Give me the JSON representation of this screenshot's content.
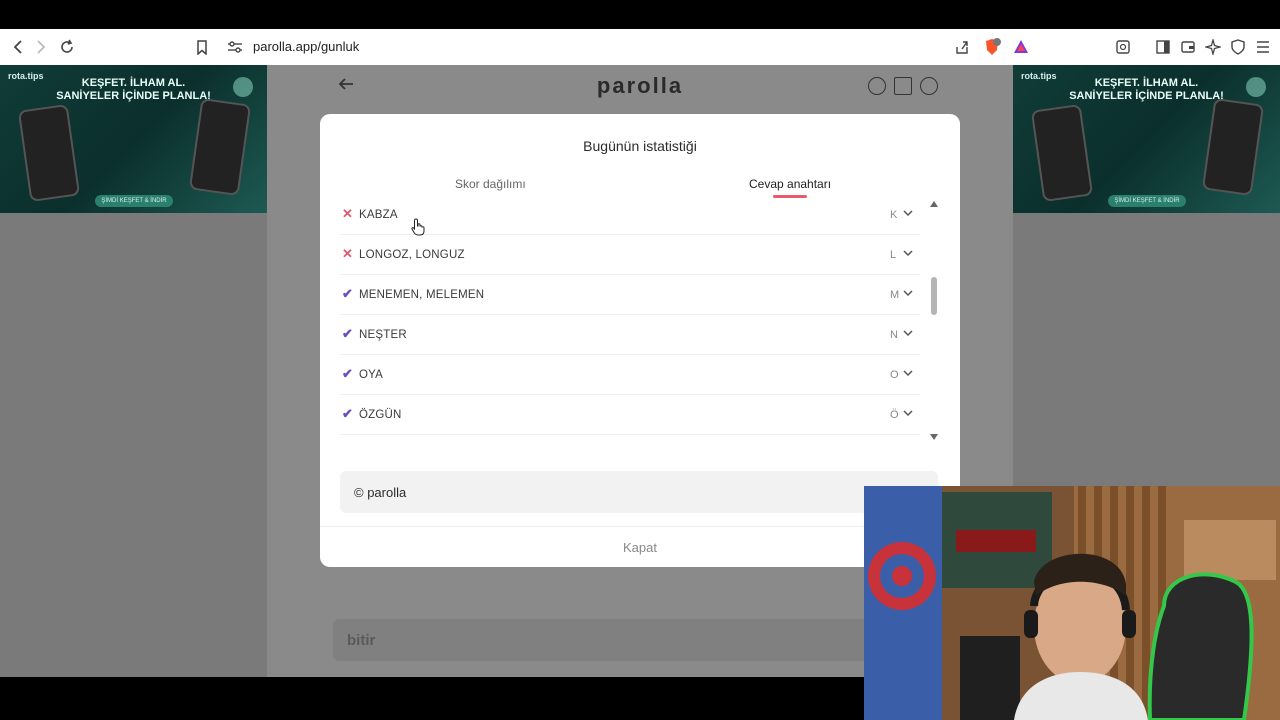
{
  "browser": {
    "url": "parolla.app/gunluk",
    "brave_badge": "1"
  },
  "ads": {
    "brand": "rota.tips",
    "headline_line1": "KEŞFET. İLHAM AL.",
    "headline_line2": "SANİYELER İÇİNDE PLANLA!",
    "cta": "ŞİMDİ KEŞFET & İNDİR"
  },
  "app": {
    "logo": "parolla",
    "bottom_input_placeholder": "bitir"
  },
  "modal": {
    "title": "Bugünün istatistiği",
    "tabs": [
      "Skor dağılımı",
      "Cevap anahtarı"
    ],
    "active_tab": "Cevap anahtarı",
    "rows": [
      {
        "word": "KABZA",
        "letter": "K",
        "status": "wrong"
      },
      {
        "word": "LONGOZ, LONGUZ",
        "letter": "L",
        "status": "wrong"
      },
      {
        "word": "MENEMEN, MELEMEN",
        "letter": "M",
        "status": "correct"
      },
      {
        "word": "NEŞTER",
        "letter": "N",
        "status": "correct"
      },
      {
        "word": "OYA",
        "letter": "O",
        "status": "correct"
      },
      {
        "word": "ÖZGÜN",
        "letter": "Ö",
        "status": "correct"
      }
    ],
    "footer": "© parolla",
    "close_label": "Kapat"
  },
  "colors": {
    "wrong": "#e05a6e",
    "correct": "#6b4fbf",
    "tab_underline": "#e85a6a"
  }
}
